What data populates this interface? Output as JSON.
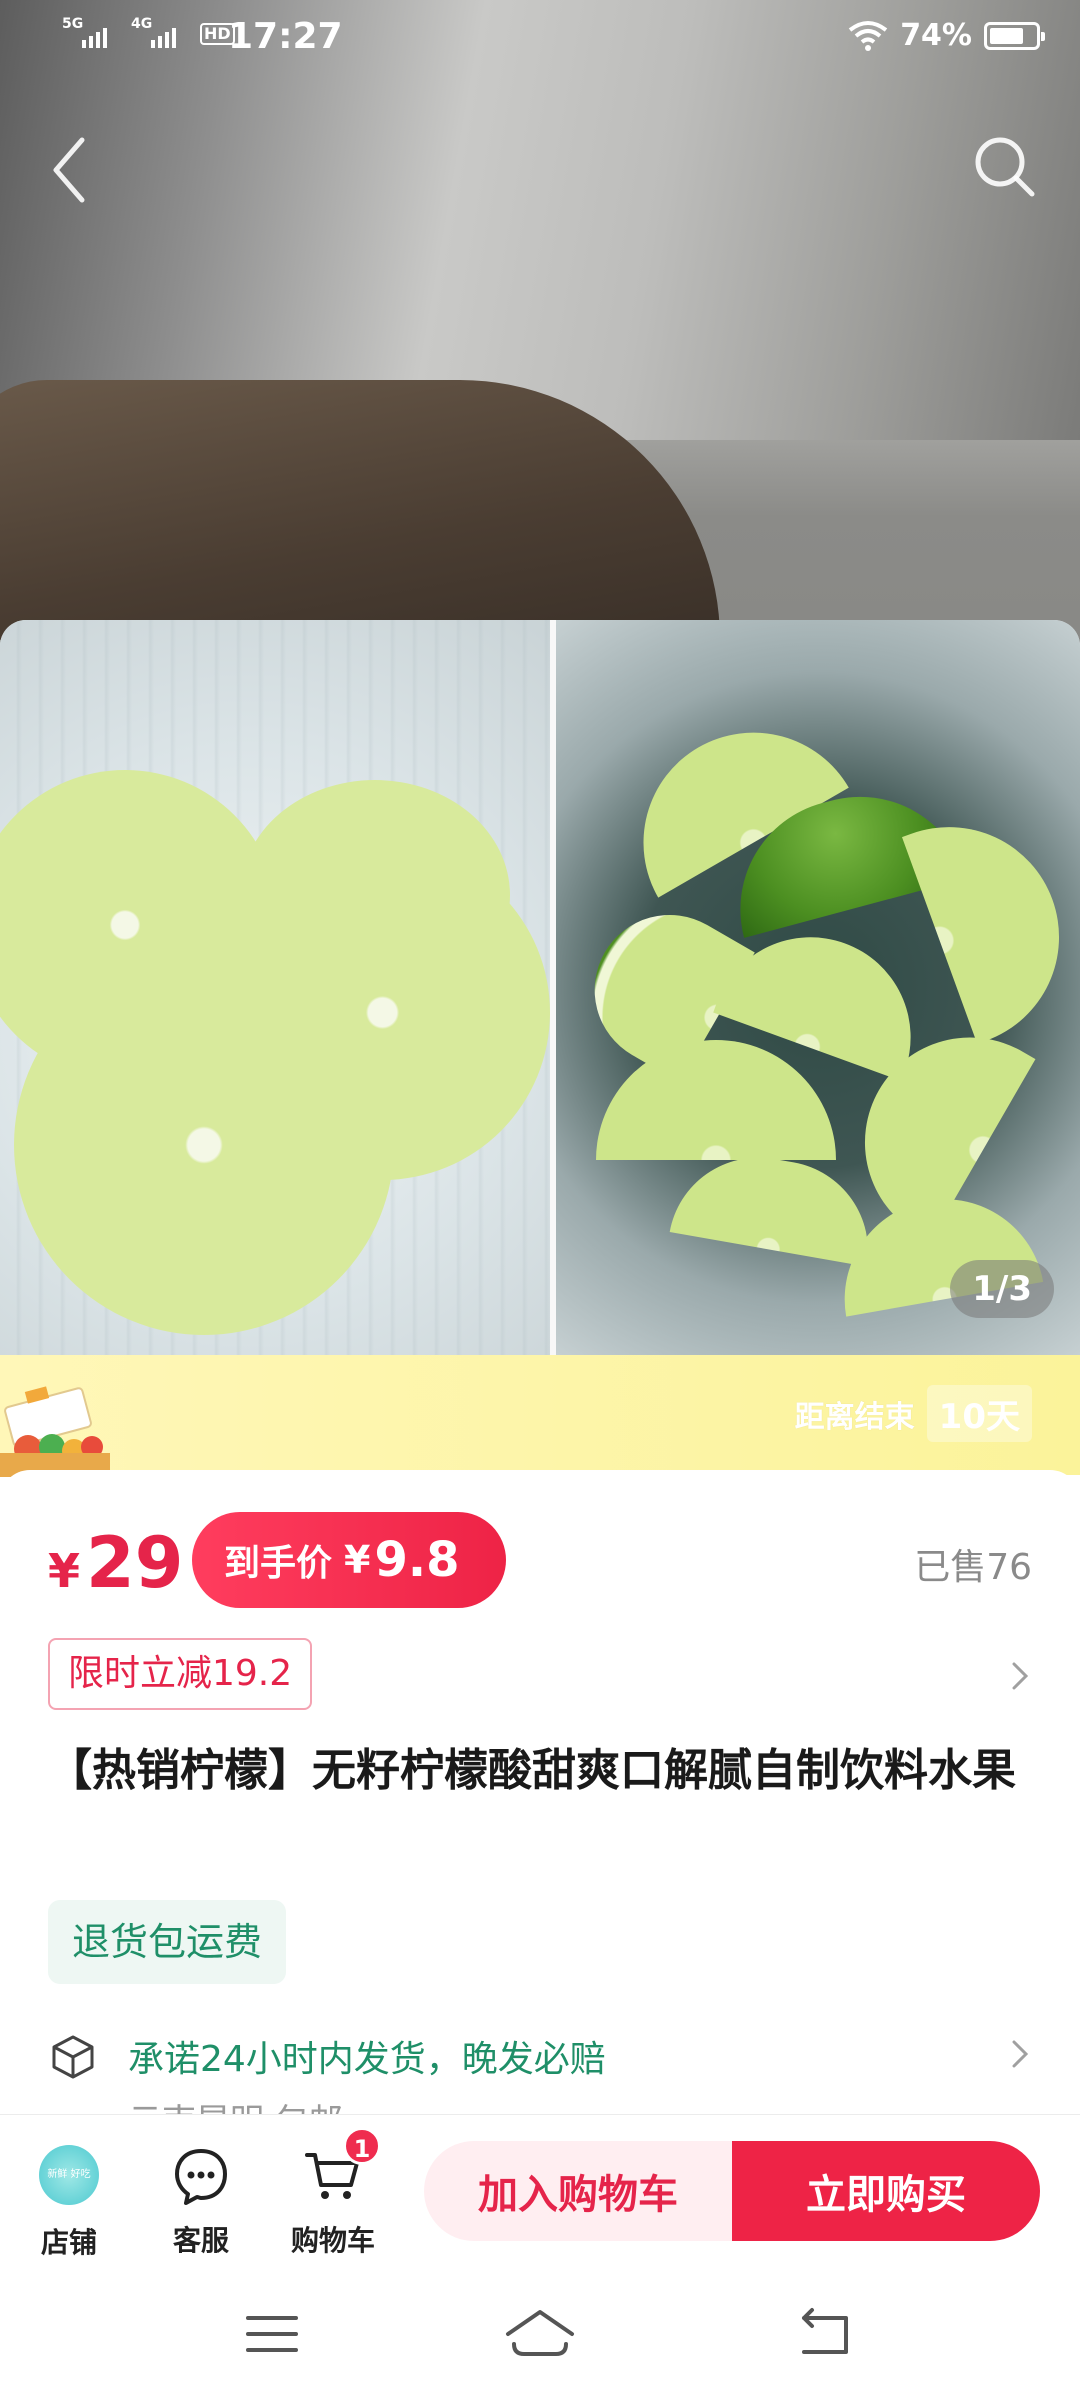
{
  "status_bar": {
    "signal1_label": "5G",
    "signal2_label": "4G",
    "hd_label": "HD",
    "time": "17:27",
    "battery_percent": "74%",
    "battery_level": 0.74
  },
  "gallery": {
    "page_indicator": "1/3"
  },
  "promo": {
    "countdown_label": "距离结束",
    "countdown_value": "10天"
  },
  "product": {
    "price_symbol": "¥",
    "price": "29",
    "final_price_label": "到手价",
    "final_price_symbol": "¥",
    "final_price": "9.8",
    "sold": "已售76",
    "discount": "限时立减19.2",
    "title": "【热销柠檬】无籽柠檬酸甜爽口解腻自制饮料水果",
    "return_badge": "退货包运费",
    "shipping_promise": "承诺24小时内发货，晚发必赔",
    "shipping_origin": "云南昆明 包邮"
  },
  "action_bar": {
    "shop_label": "店铺",
    "shop_logo_text": "新鲜 好吃",
    "service_label": "客服",
    "cart_label": "购物车",
    "cart_count": "1",
    "add_to_cart": "加入购物车",
    "buy_now": "立即购买"
  },
  "colors": {
    "accent_red": "#ee2346",
    "green_text": "#1f8f68",
    "promo_yellow": "#fbf39a"
  },
  "icons": [
    "back-icon",
    "search-icon",
    "store-icon",
    "chat-icon",
    "cart-icon",
    "menu-icon",
    "home-icon",
    "return-icon",
    "box-icon",
    "chevron-right-icon"
  ]
}
